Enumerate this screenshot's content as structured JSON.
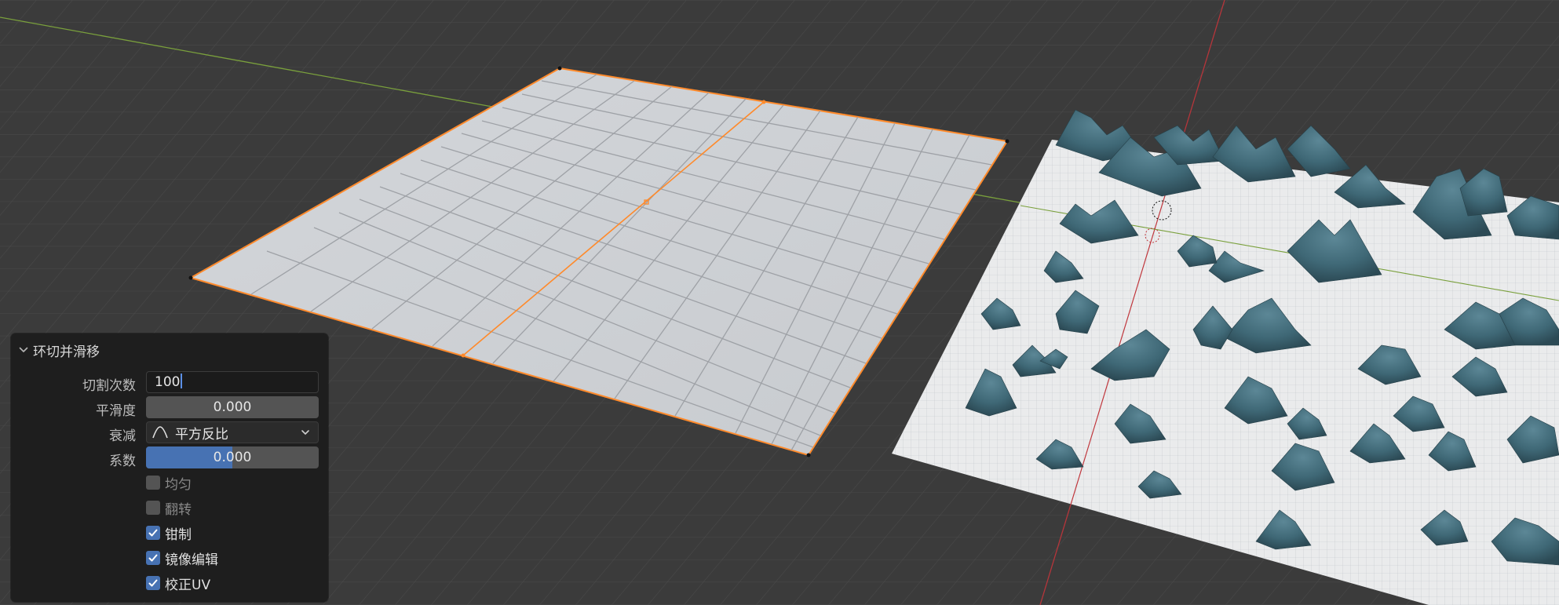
{
  "panel": {
    "title": "环切并滑移",
    "fields": {
      "cuts": {
        "label": "切割次数",
        "value": "100"
      },
      "smoothness": {
        "label": "平滑度",
        "value": "0.000"
      },
      "falloff": {
        "label": "衰减",
        "value": "平方反比"
      },
      "factor": {
        "label": "系数",
        "value": "0.000",
        "fill": 0.5
      }
    },
    "options": [
      {
        "label": "均匀",
        "checked": false
      },
      {
        "label": "翻转",
        "checked": false
      },
      {
        "label": "钳制",
        "checked": true
      },
      {
        "label": "镜像编辑",
        "checked": true
      },
      {
        "label": "校正UV",
        "checked": true
      }
    ]
  },
  "colors": {
    "background": "#3b3b3b",
    "accent_blue": "#4772b3",
    "selection_orange": "#ff8a2b",
    "x_axis_red": "#c0373d",
    "y_axis_green": "#7aa03c",
    "mountain_teal": "#3f6876"
  }
}
